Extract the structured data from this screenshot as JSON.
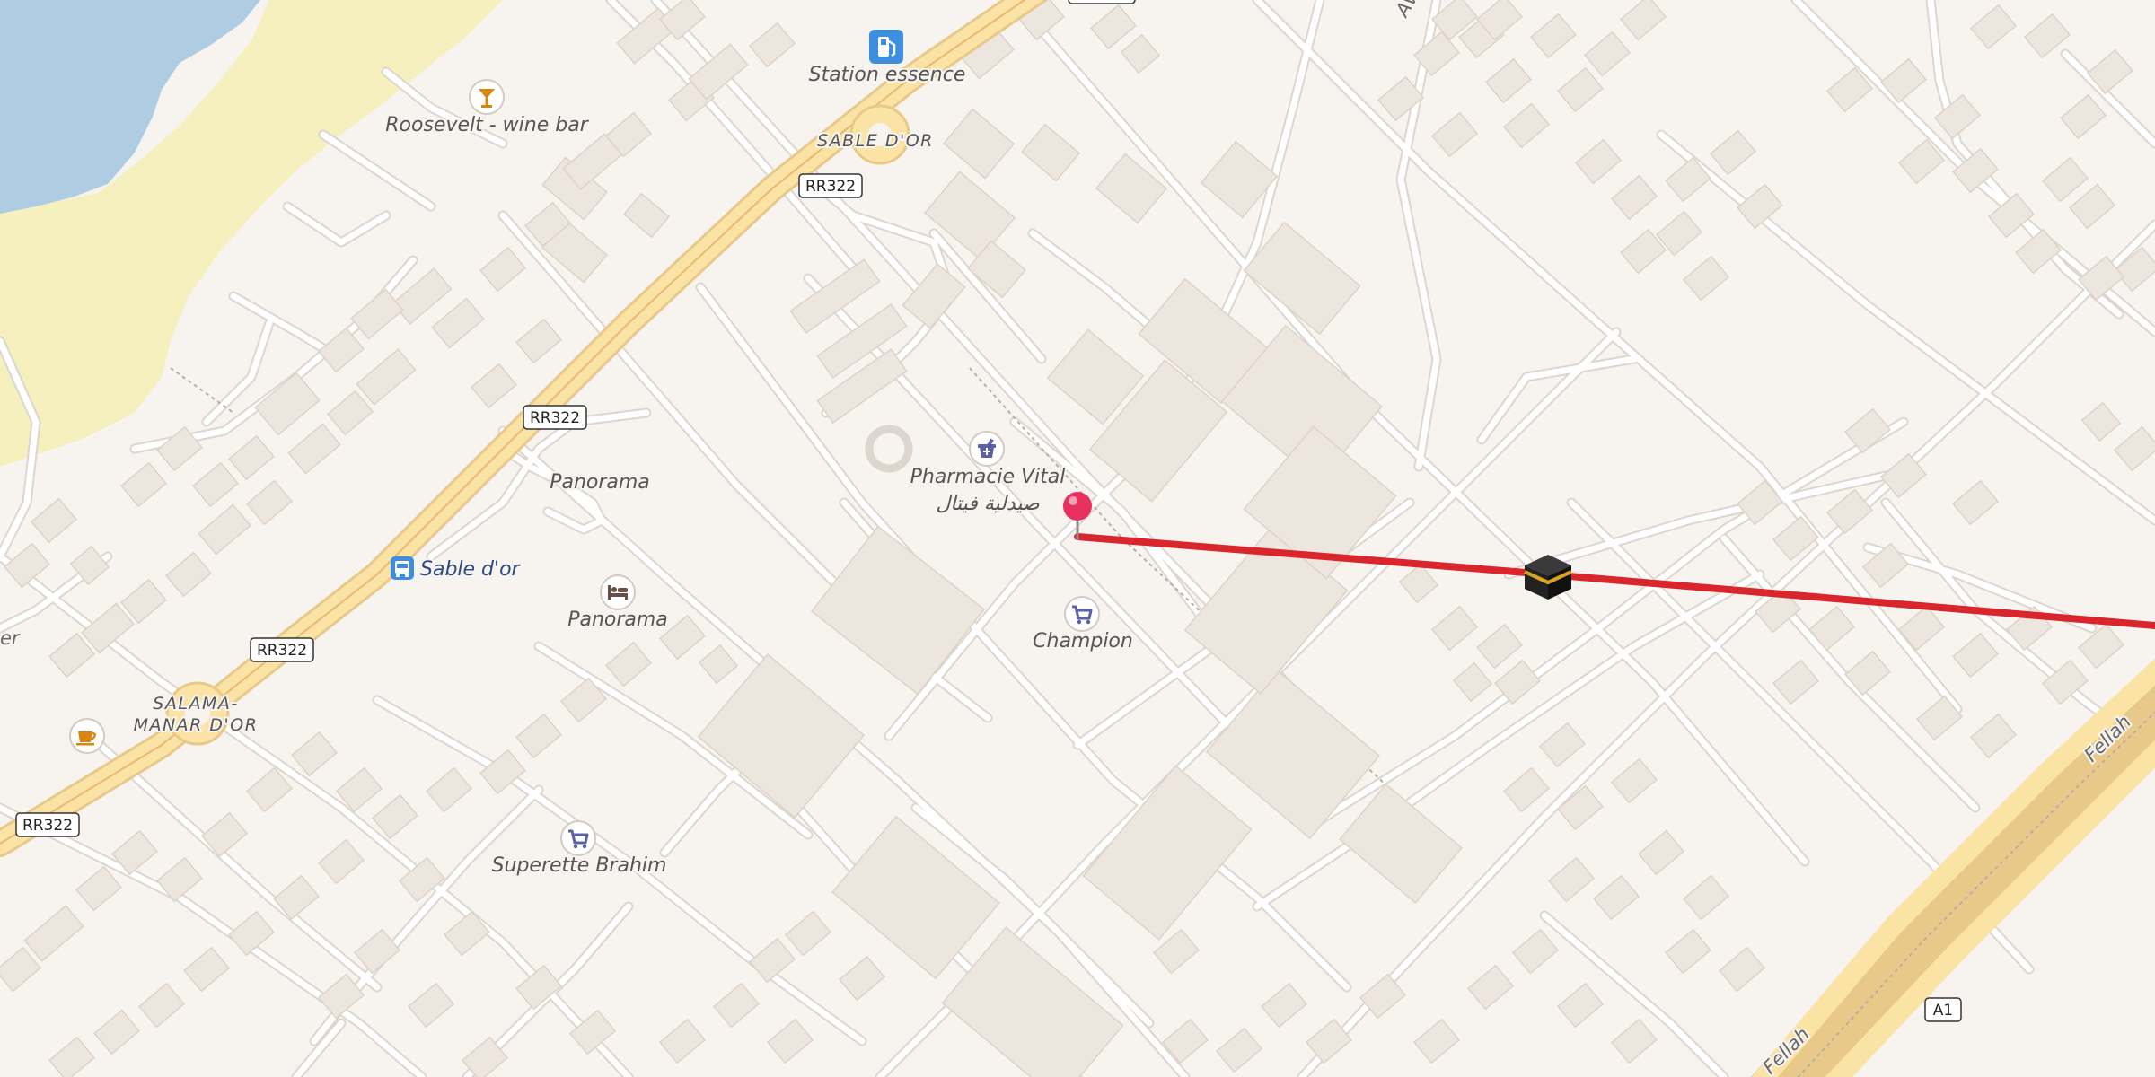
{
  "map": {
    "pois": {
      "station": "Station essence",
      "winebar": "Roosevelt - wine bar",
      "pharmacy": "Pharmacie Vital",
      "pharmacy_ar": "صيدلية فيتال",
      "panorama1": "Panorama",
      "panorama2": "Panorama",
      "champion": "Champion",
      "superette": "Superette Brahim",
      "bus_stop": "Sable d'or"
    },
    "places": {
      "sable_dor": "SABLE D'OR",
      "salama1": "SALAMA-",
      "salama2": "MANAR D'OR"
    },
    "streets": {
      "fellah1": "Fellah",
      "fellah2": "Fellah",
      "av": "Av",
      "er": "er"
    },
    "shields": {
      "rr322_a": "RR322",
      "rr322_b": "RR322",
      "rr322_c": "RR322",
      "rr322_d": "RR322",
      "a1": "A1"
    },
    "icons": {
      "fuel": "fuel-icon",
      "cocktail": "cocktail-icon",
      "pharmacy": "pharmacy-icon",
      "shop": "shopping-cart-icon",
      "bus": "bus-icon",
      "hotel": "bed-icon",
      "cafe": "coffee-cup-icon",
      "pin": "location-pin-icon",
      "kaaba": "kaaba-icon"
    },
    "colors": {
      "water": "#aecde3",
      "sand": "#f6efbe",
      "route": "#d9262c",
      "pin": "#e8305f",
      "highway": "#fbe3a6",
      "poi_blue": "#5c62a8",
      "poi_orange": "#d9860f"
    }
  }
}
